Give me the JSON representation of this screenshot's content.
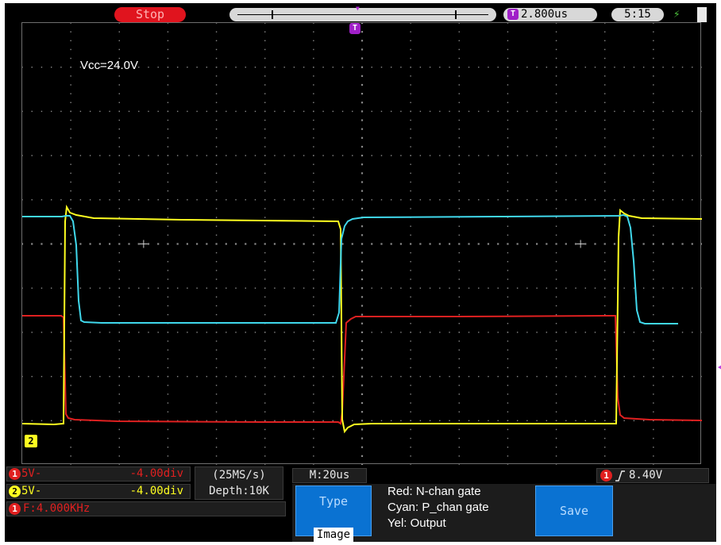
{
  "status": {
    "run_state": "Stop",
    "trigger_time": "2.800us",
    "clock": "5:15"
  },
  "screen": {
    "vcc_label": "Vcc=24.0V",
    "ch2_marker": "2"
  },
  "channels": [
    {
      "badge": "1",
      "volts": "5V-",
      "offset": "-4.00div",
      "color": "#e02020"
    },
    {
      "badge": "2",
      "volts": "5V-",
      "offset": "-4.00div",
      "color": "#ffff20"
    }
  ],
  "frequency": {
    "badge": "1",
    "text": "F:4.000KHz"
  },
  "acquisition": {
    "sample_rate": "(25MS/s)",
    "depth": "Depth:10K"
  },
  "timebase": "M:20us",
  "trigger": {
    "badge": "1",
    "level": "8.40V"
  },
  "menu": {
    "type_label": "Type",
    "type_value": "Image",
    "save_label": "Save"
  },
  "legend": {
    "red": "Red: N-chan gate",
    "cyan": "Cyan: P_chan gate",
    "yellow": "Yel: Output"
  },
  "colors": {
    "red_trace": "#e02020",
    "cyan_trace": "#40d8ec",
    "yellow_trace": "#ffff20",
    "menu_button": "#0a72d2",
    "trigger_marker": "#c040e0"
  }
}
